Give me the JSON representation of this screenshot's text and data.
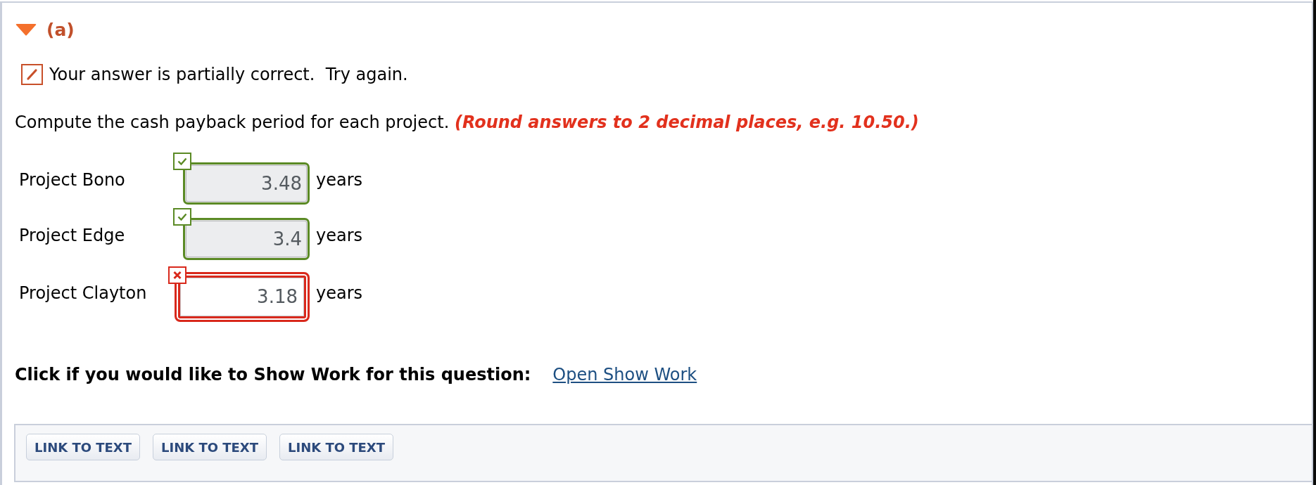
{
  "part": {
    "label": "(a)",
    "expanded": true
  },
  "feedback": {
    "kind": "partial",
    "text": "Your answer is partially correct.  Try again."
  },
  "instruction": {
    "text": "Compute the cash payback period for each project.",
    "note": "(Round answers to 2 decimal places, e.g. 10.50.)"
  },
  "answers": [
    {
      "label": "Project Bono",
      "value": "3.48",
      "unit": "years",
      "correct": true
    },
    {
      "label": "Project Edge",
      "value": "3.4",
      "unit": "years",
      "correct": true
    },
    {
      "label": "Project Clayton",
      "value": "3.18",
      "unit": "years",
      "correct": false
    }
  ],
  "show_work": {
    "prompt": "Click if you would like to Show Work for this question:",
    "link": "Open Show Work"
  },
  "links": [
    "LINK TO TEXT",
    "LINK TO TEXT",
    "LINK TO TEXT"
  ]
}
